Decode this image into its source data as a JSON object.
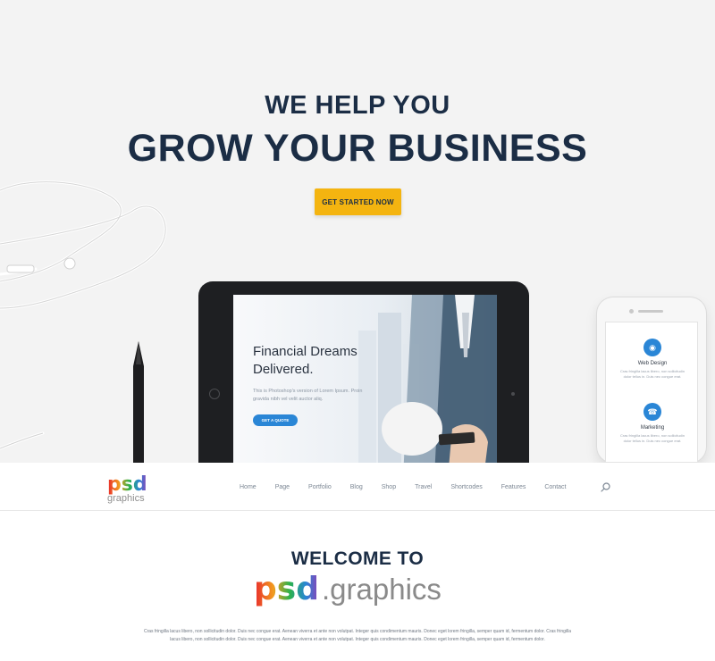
{
  "hero": {
    "line1": "WE HELP YOU",
    "line2": "GROW YOUR BUSINESS",
    "cta_label": "GET STARTED NOW"
  },
  "tablet": {
    "slide_title": "Financial Dreams\nDelivered.",
    "slide_text": "This is Photoshop's version of Lorem Ipsum. Proin gravida nibh vel velit auctor aliq.",
    "slide_button": "GET A QUOTE"
  },
  "phone": {
    "features": [
      {
        "icon": "monitor-icon",
        "title": "Web Design",
        "text": "Cras fringilla lacus libero, non sollicitudin dolor tellus in. Duis nec congue erat."
      },
      {
        "icon": "headset-icon",
        "title": "Marketing",
        "text": "Cras fringilla lacus libero, non sollicitudin dolor tellus in. Duis nec congue erat."
      }
    ]
  },
  "nav": {
    "logo_text": "psd",
    "logo_subtext": "graphics",
    "items": [
      "Home",
      "Page",
      "Portfolio",
      "Blog",
      "Shop",
      "Travel",
      "Shortcodes",
      "Features",
      "Contact"
    ]
  },
  "welcome": {
    "title": "WELCOME TO",
    "logo_text": "psd",
    "logo_subtext": ".graphics",
    "body": "Cras fringilla lacus libero, non sollicitudin dolor. Duis nec congue erat. Aenean viverra et ante non volutpat. Integer quis condimentum mauris. Donec eget lorem fringilla, semper quam id, fermentum dolor. Cras fringilla lacus libero, non sollicitudin dolor. Duis nec congue erat. Aenean viverra et ante non volutpat. Integer quis condimentum mauris. Donec eget lorem fringilla, semper quam id, fermentum dolor."
  },
  "colors": {
    "navy": "#1b2d45",
    "accent_yellow": "#f4b410",
    "accent_blue": "#2a86d6"
  }
}
